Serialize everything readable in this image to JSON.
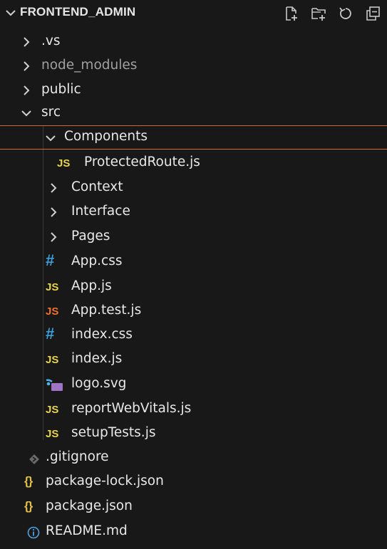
{
  "explorer": {
    "title": "FRONTEND_ADMIN",
    "actions": [
      {
        "name": "new-file-icon"
      },
      {
        "name": "new-folder-icon"
      },
      {
        "name": "refresh-icon"
      },
      {
        "name": "collapse-all-icon"
      }
    ]
  },
  "tree": {
    "vs": ".vs",
    "node_modules": "node_modules",
    "public": "public",
    "src": "src",
    "components": "Components",
    "protected_route": "ProtectedRoute.js",
    "context": "Context",
    "interface": "Interface",
    "pages": "Pages",
    "app_css": "App.css",
    "app_js": "App.js",
    "app_test_js": "App.test.js",
    "index_css": "index.css",
    "index_js": "index.js",
    "logo_svg": "logo.svg",
    "report_web_vitals": "reportWebVitals.js",
    "setup_tests": "setupTests.js",
    "gitignore": ".gitignore",
    "package_lock": "package-lock.json",
    "package_json": "package.json",
    "readme": "README.md"
  },
  "icons": {
    "js": "JS",
    "hash": "#",
    "braces": "{}"
  },
  "colors": {
    "background": "#181818",
    "focus_border": "#cc6b2c",
    "js_yellow": "#e8d44d",
    "js_test_orange": "#f0712c",
    "css_blue": "#3c9fda",
    "json_yellow": "#e2c048",
    "svg_purple": "#a074c4",
    "info_blue": "#4fa1e0"
  }
}
